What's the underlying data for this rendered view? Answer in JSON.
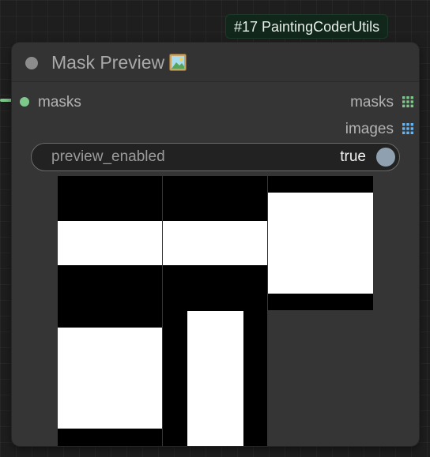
{
  "badge": {
    "text": "#17 PaintingCoderUtils"
  },
  "node": {
    "title": "Mask Preview",
    "title_icon": "framed-picture-icon"
  },
  "slots": {
    "input_label": "masks",
    "outputs": [
      {
        "label": "masks",
        "icon": "grid-icon",
        "color": "#7dc88a"
      },
      {
        "label": "images",
        "icon": "grid-icon",
        "color": "#64b5f6"
      }
    ]
  },
  "widget": {
    "name": "preview_enabled",
    "value": "true"
  },
  "colors": {
    "mask_background": "#000000",
    "mask_fill": "#ffffff",
    "canvas_background": "#1e1e1e",
    "node_body": "#353535",
    "input_slot": "#7dc88a"
  }
}
